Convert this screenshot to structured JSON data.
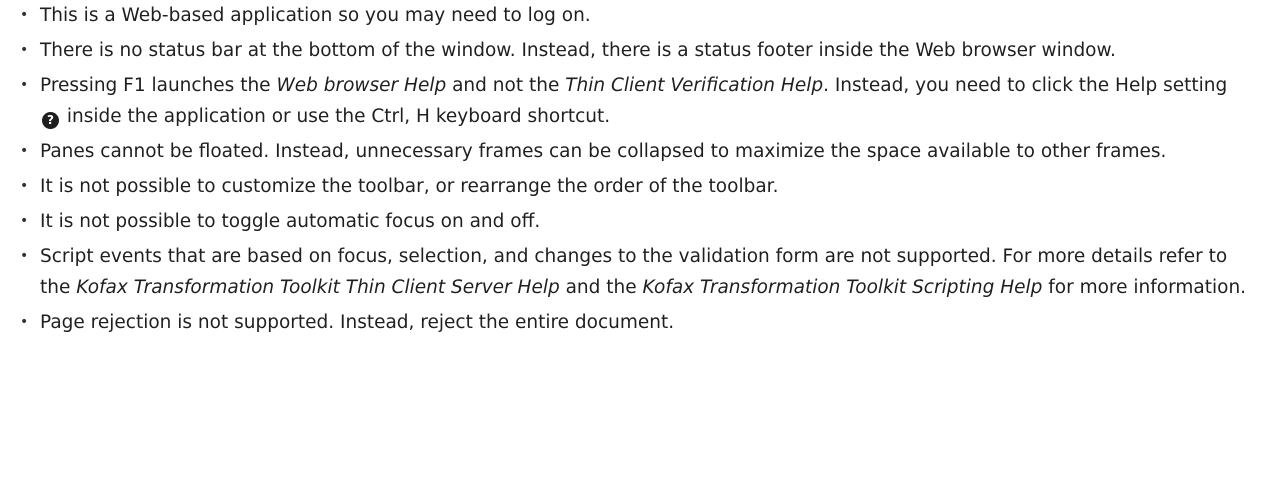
{
  "bullets": [
    {
      "text": "This is a Web-based application so you may need to log on."
    },
    {
      "text": "There is no status bar at the bottom of the window. Instead, there is a status footer inside the Web browser window."
    },
    {
      "p1": "Pressing F1 launches the ",
      "em1": "Web browser Help",
      "p2": " and not the  ",
      "em2": "Thin Client Verification Help",
      "p3": ". Instead, you need to click the Help setting ",
      "icon": "?",
      "p4": " inside the application or use the Ctrl, H keyboard shortcut."
    },
    {
      "text": "Panes cannot be floated. Instead, unnecessary frames can be collapsed to maximize the space available to other frames."
    },
    {
      "text": "It is not possible to customize the toolbar, or rearrange the order of the toolbar."
    },
    {
      "text": "It is not possible to toggle automatic focus on and off."
    },
    {
      "p1": "Script events that are based on focus, selection, and changes to the validation form are not supported. For more details refer to the ",
      "em1": "Kofax Transformation Toolkit Thin Client Server Help",
      "p2": " and the ",
      "em2": "Kofax Transformation Toolkit Scripting Help",
      "p3": " for more information."
    },
    {
      "text": "Page rejection is not supported. Instead, reject the entire document."
    }
  ],
  "icons": {
    "help": "help-circle-icon"
  },
  "colors": {
    "text": "#1f1f1f",
    "background": "#ffffff"
  }
}
